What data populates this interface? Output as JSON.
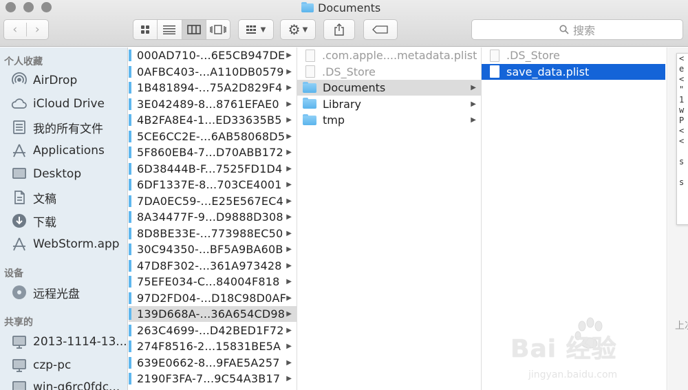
{
  "window": {
    "title": "Documents"
  },
  "toolbar": {
    "back_glyph": "‹",
    "forward_glyph": "›",
    "search_placeholder": "搜索"
  },
  "sidebar": {
    "favorites_header": "个人收藏",
    "favorites": [
      {
        "label": "AirDrop",
        "icon": "airdrop-icon"
      },
      {
        "label": "iCloud Drive",
        "icon": "cloud-icon"
      },
      {
        "label": "我的所有文件",
        "icon": "all-files-icon"
      },
      {
        "label": "Applications",
        "icon": "applications-icon"
      },
      {
        "label": "Desktop",
        "icon": "desktop-icon"
      },
      {
        "label": "文稿",
        "icon": "documents-icon"
      },
      {
        "label": "下载",
        "icon": "download-icon"
      },
      {
        "label": "WebStorm.app",
        "icon": "app-icon"
      }
    ],
    "devices_header": "设备",
    "devices": [
      {
        "label": "远程光盘",
        "icon": "disc-icon"
      }
    ],
    "shared_header": "共享的",
    "shared": [
      {
        "label": "2013-1114-13...",
        "icon": "computer-icon"
      },
      {
        "label": "czp-pc",
        "icon": "computer-icon"
      },
      {
        "label": "win-g6rc0fdc...",
        "icon": "computer-icon"
      }
    ]
  },
  "column1": {
    "selected_index": 16,
    "items": [
      "000AD710-...6E5CB947DE",
      "0AFBC403-...A110DB0579",
      "1B481894-...75A2D829F4",
      "3E042489-8...8761EFAE0",
      "4B2FA8E4-1...ED33635B5",
      "5CE6CC2E-...6AB58068D5",
      "5F860EB4-7...D70ABB172",
      "6D38444B-F...7525FD1D4",
      "6DF1337E-8...703CE4001",
      "7DA0EC59-...E25E567EC4",
      "8A34477F-9...D9888D308",
      "8D8BE33E-...773988EC50",
      "30C94350-...BF5A9BA60B",
      "47D8F302-...361A973428",
      "75EFE034-C...84004F818",
      "97D2FD04-...D18C98D0AF",
      "139D668A-...36A654CD98",
      "263C4699-...D42BED1F72",
      "274F8516-2...15831BE5A",
      "639E0662-8...9FAE5A257",
      "2190F3FA-7...9C54A3B17"
    ]
  },
  "column2": {
    "files": [
      ".com.apple....metadata.plist",
      ".DS_Store"
    ],
    "folders": [
      {
        "label": "Documents",
        "selected": true
      },
      {
        "label": "Library",
        "selected": false
      },
      {
        "label": "tmp",
        "selected": false
      }
    ]
  },
  "column3": {
    "items": [
      {
        "label": ".DS_Store",
        "selected": false
      },
      {
        "label": "save_data.plist",
        "selected": true
      }
    ]
  },
  "preview": {
    "lines": [
      "<",
      "e",
      "<",
      "\"",
      "1",
      "w",
      "P",
      "<",
      "<",
      "",
      "s",
      "",
      "s"
    ],
    "caption": "上次"
  },
  "watermark": {
    "logo": "Bai  经验",
    "url": "jingyan.baidu.com"
  },
  "colors": {
    "selection_blue": "#1464d8",
    "folder_blue": "#5bb4ec",
    "sidebar_bg": "#e5edf3"
  }
}
